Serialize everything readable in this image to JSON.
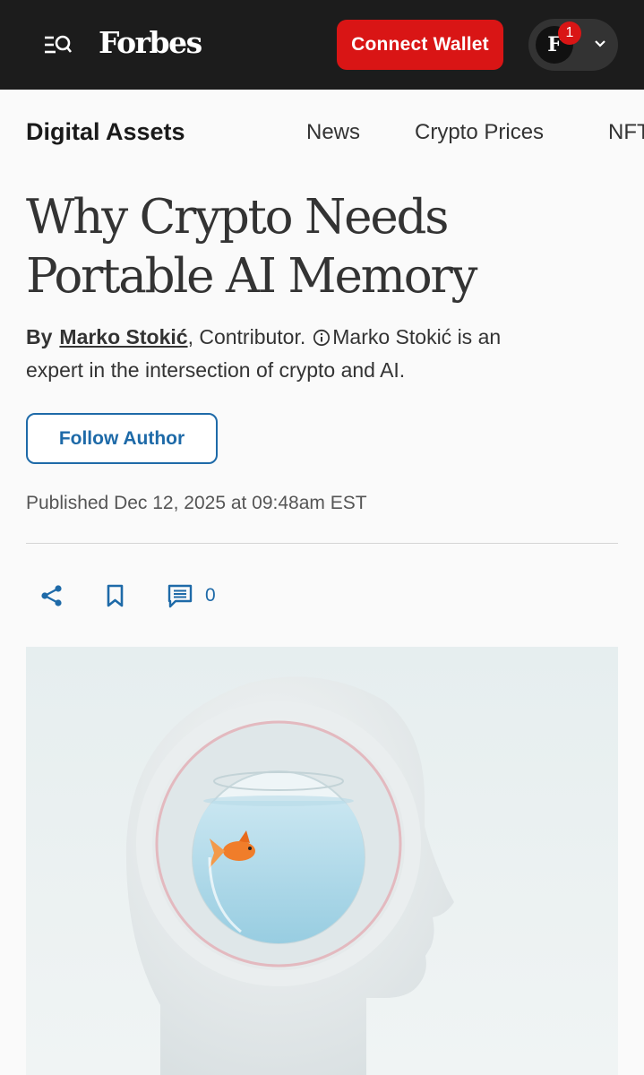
{
  "header": {
    "logo": "Forbes",
    "connect_wallet_label": "Connect Wallet",
    "avatar_letter": "F",
    "notification_count": "1"
  },
  "section": {
    "title": "Digital Assets",
    "nav_links": [
      "News",
      "Crypto Prices",
      "NFT"
    ]
  },
  "article": {
    "headline": "Why Crypto Needs Portable AI Memory",
    "byline": {
      "by": "By",
      "author": "Marko Stokić",
      "role": ", Contributor.",
      "bio": "Marko Stokić is an expert in the intersection of crypto and AI."
    },
    "follow_label": "Follow Author",
    "published": "Published Dec 12, 2025 at 09:48am EST",
    "comment_count": "0"
  },
  "icons": [
    "menu-search-icon",
    "chevron-down-icon",
    "info-icon",
    "share-icon",
    "bookmark-icon",
    "comment-icon"
  ],
  "colors": {
    "topbar": "#1c1c1c",
    "accent_red": "#d91515",
    "link_blue": "#1e6aa8"
  }
}
